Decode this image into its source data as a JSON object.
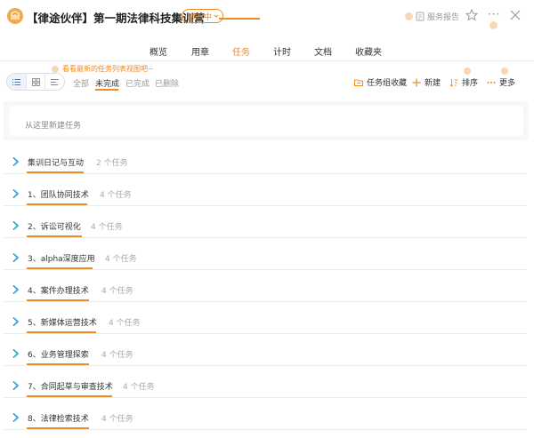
{
  "header": {
    "title": "【律途伙伴】第一期法律科技集训营",
    "status": "进行中",
    "report_label": "服务报告",
    "more_label": "···"
  },
  "tabs": [
    {
      "label": "概览",
      "active": false
    },
    {
      "label": "用章",
      "active": false
    },
    {
      "label": "任务",
      "active": true
    },
    {
      "label": "计时",
      "active": false
    },
    {
      "label": "文档",
      "active": false
    },
    {
      "label": "收藏夹",
      "active": false
    }
  ],
  "toolbar": {
    "hint": "看看最新的任务列表视图吧~",
    "filters": [
      {
        "label": "全部",
        "active": false
      },
      {
        "label": "未完成",
        "active": true
      },
      {
        "label": "已完成",
        "active": false
      },
      {
        "label": "已删除",
        "active": false
      }
    ],
    "collect_label": "任务组收藏",
    "new_label": "新建",
    "sort_label": "排序",
    "more_label": "更多"
  },
  "new_task": {
    "placeholder": "从这里新建任务"
  },
  "groups": [
    {
      "name": "集训日记与互动",
      "count": "2 个任务"
    },
    {
      "name": "1、团队协同技术",
      "count": "4 个任务"
    },
    {
      "name": "2、诉讼可视化",
      "count": "4 个任务"
    },
    {
      "name": "3、alpha深度应用",
      "count": "4 个任务"
    },
    {
      "name": "4、案件办理技术",
      "count": "4 个任务"
    },
    {
      "name": "5、新媒体运营技术",
      "count": "4 个任务"
    },
    {
      "name": "6、业务管理探索",
      "count": "4 个任务"
    },
    {
      "name": "7、合同起草与审查技术",
      "count": "4 个任务"
    },
    {
      "name": "8、法律检索技术",
      "count": "4 个任务"
    }
  ],
  "colors": {
    "accent": "#f08a24",
    "arrow": "#2a9fd6"
  }
}
